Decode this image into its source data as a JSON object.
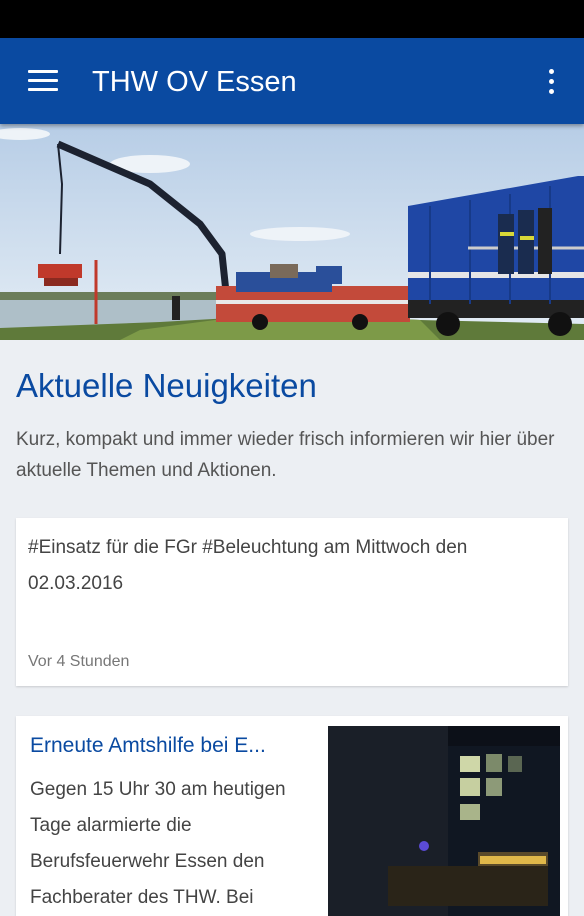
{
  "app": {
    "title": "THW OV Essen",
    "accent_color": "#0a4aa1",
    "menu_icon": "hamburger-menu-icon",
    "overflow_icon": "more-vertical-icon"
  },
  "hero": {
    "image": "thw-crane-truck-riverside-photo"
  },
  "section": {
    "title": "Aktuelle Neuigkeiten",
    "description": "Kurz, kompakt und immer wieder frisch informieren wir hier über aktuelle Themen und Aktionen."
  },
  "posts": [
    {
      "text": "#Einsatz für die FGr #Beleuchtung am Mittwoch den 02.03.2016",
      "time": "Vor 4 Stunden"
    }
  ],
  "articles": [
    {
      "title": "Erneute Amtshilfe bei E...",
      "excerpt": "Gegen 15 Uhr 30 am heutigen Tage alarmierte die Berufsfeuerwehr Essen den Fachberater des THW. Bei",
      "image": "night-building-fire-truck-photo"
    }
  ]
}
